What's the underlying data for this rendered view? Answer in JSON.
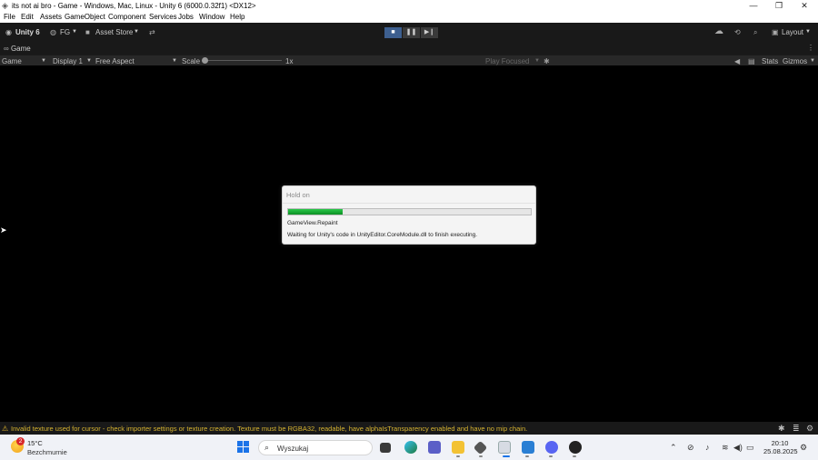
{
  "window": {
    "title": "its not ai bro - Game - Windows, Mac, Linux - Unity 6 (6000.0.32f1) <DX12>",
    "controls": {
      "minimize": "—",
      "restore": "❐",
      "close": "✕"
    }
  },
  "menu": [
    "File",
    "Edit",
    "Assets",
    "GameObject",
    "Component",
    "Services",
    "Jobs",
    "Window",
    "Help"
  ],
  "toolbar": {
    "unity_label": "Unity 6",
    "account_label": "FG",
    "asset_store_label": "Asset Store",
    "layout_label": "Layout"
  },
  "game_tab": {
    "label": "Game"
  },
  "game_toolbar": {
    "view_mode": "Game",
    "display": "Display 1",
    "aspect": "Free Aspect",
    "scale_label": "Scale",
    "scale_value": "1x",
    "play_mode": "Play Focused",
    "stats": "Stats",
    "gizmos": "Gizmos"
  },
  "dialog": {
    "title": "Hold on",
    "task": "GameView.Repaint",
    "message": "Waiting for Unity's code in UnityEditor.CoreModule.dll to finish executing.",
    "progress": 0.225,
    "progress_color": "#06b025"
  },
  "status_bar": {
    "warning": "Invalid texture used for cursor - check importer settings or texture creation. Texture must be RGBA32, readable, have alphaIsTransparency enabled and have no mip chain.",
    "warning_color": "#d7b431"
  },
  "taskbar": {
    "weather_temp": "15°C",
    "weather_condition": "Bezchmurnie",
    "weather_badge": "2",
    "search_placeholder": "Wyszukaj",
    "time": "20:10",
    "date": "25.08.2025"
  },
  "colors": {
    "accent_play": "#3d5f8f",
    "editor_dark": "#191919"
  }
}
